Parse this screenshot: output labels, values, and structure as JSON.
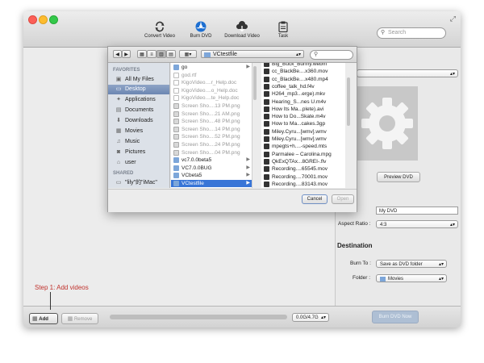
{
  "toolbar": {
    "convert_label": "Convert Video",
    "burn_label": "Burn DVD",
    "download_label": "Download Video",
    "task_label": "Task",
    "search_placeholder": "Search"
  },
  "right_panel": {
    "preview_label": "Preview DVD",
    "dvd_name_value": "My DVD",
    "aspect_label": "Aspect Ratio :",
    "aspect_value": "4:3",
    "destination_label": "Destination",
    "burn_to_label": "Burn To :",
    "burn_to_value": "Save as DVD folder",
    "folder_label": "Folder :",
    "folder_value": "Movies"
  },
  "bottom": {
    "step_text": "Step 1: Add videos",
    "add_label": "Add",
    "remove_label": "Remove",
    "size_value": "0.0G/4.7G",
    "burn_now_label": "Burn DVD Now"
  },
  "dialog": {
    "path_value": "VCtestfile",
    "cancel_label": "Cancel",
    "open_label": "Open",
    "favorites_label": "FAVORITES",
    "shared_label": "SHARED",
    "sidebar": [
      {
        "label": "All My Files",
        "icon": "files-icon",
        "active": false
      },
      {
        "label": "Desktop",
        "icon": "desktop-icon",
        "active": true
      },
      {
        "label": "Applications",
        "icon": "applications-icon",
        "active": false
      },
      {
        "label": "Documents",
        "icon": "documents-icon",
        "active": false
      },
      {
        "label": "Downloads",
        "icon": "downloads-icon",
        "active": false
      },
      {
        "label": "Movies",
        "icon": "movies-icon",
        "active": false
      },
      {
        "label": "Music",
        "icon": "music-icon",
        "active": false
      },
      {
        "label": "Pictures",
        "icon": "pictures-icon",
        "active": false
      },
      {
        "label": "user",
        "icon": "home-icon",
        "active": false
      }
    ],
    "shared_item": "\"lily\"的\"iMac\"",
    "column1": [
      {
        "name": "go",
        "kind": "folder",
        "dim": false,
        "chevron": true
      },
      {
        "name": "god.rtf",
        "kind": "doc",
        "dim": true,
        "chevron": false
      },
      {
        "name": "KigoVideo....r_Help.doc",
        "kind": "doc",
        "dim": true,
        "chevron": false
      },
      {
        "name": "KigoVideo....o_Help.doc",
        "kind": "doc",
        "dim": true,
        "chevron": false
      },
      {
        "name": "KigoVideo....te_Help.doc",
        "kind": "doc",
        "dim": true,
        "chevron": false
      },
      {
        "name": "Screen Sho....13 PM.png",
        "kind": "img",
        "dim": true,
        "chevron": false
      },
      {
        "name": "Screen Sho....21 AM.png",
        "kind": "img",
        "dim": true,
        "chevron": false
      },
      {
        "name": "Screen Sho....48 PM.png",
        "kind": "img",
        "dim": true,
        "chevron": false
      },
      {
        "name": "Screen Sho....14 PM.png",
        "kind": "img",
        "dim": true,
        "chevron": false
      },
      {
        "name": "Screen Sho....52 PM.png",
        "kind": "img",
        "dim": true,
        "chevron": false
      },
      {
        "name": "Screen Sho....24 PM.png",
        "kind": "img",
        "dim": true,
        "chevron": false
      },
      {
        "name": "Screen Sho....04 PM.png",
        "kind": "img",
        "dim": true,
        "chevron": false
      },
      {
        "name": "vc7.0.0beta5",
        "kind": "folder",
        "dim": false,
        "chevron": true
      },
      {
        "name": "VC7.0.0BUG",
        "kind": "folder",
        "dim": false,
        "chevron": true
      },
      {
        "name": "VCbeta5",
        "kind": "folder",
        "dim": false,
        "chevron": true
      },
      {
        "name": "VCtestfile",
        "kind": "folder",
        "dim": false,
        "chevron": true,
        "selected": true
      }
    ],
    "column2": [
      "Big_Buck_Bunny.webm",
      "cc_BlackBe....x360.mov",
      "cc_BlackBe....x480.mp4",
      "coffee_talk_hd.f4v",
      "H264_mp3...erge).mkv",
      "Hearing_S...nes U.m4v",
      "How Its Ma...plete).avi",
      "How to Do...Skate.m4v",
      "How to Ma...cakes.3gp",
      "Miley.Cyru...[wmv].wmv",
      "Miley.Cyru...[wmv].wmv",
      "mpegts+h....-speed.mts",
      "Parmalee – Carolina.mpg",
      "QkExQTAx...8GREI-.flv",
      "Recording....65545.mov",
      "Recording....70001.mov",
      "Recording....83143.mov"
    ]
  }
}
